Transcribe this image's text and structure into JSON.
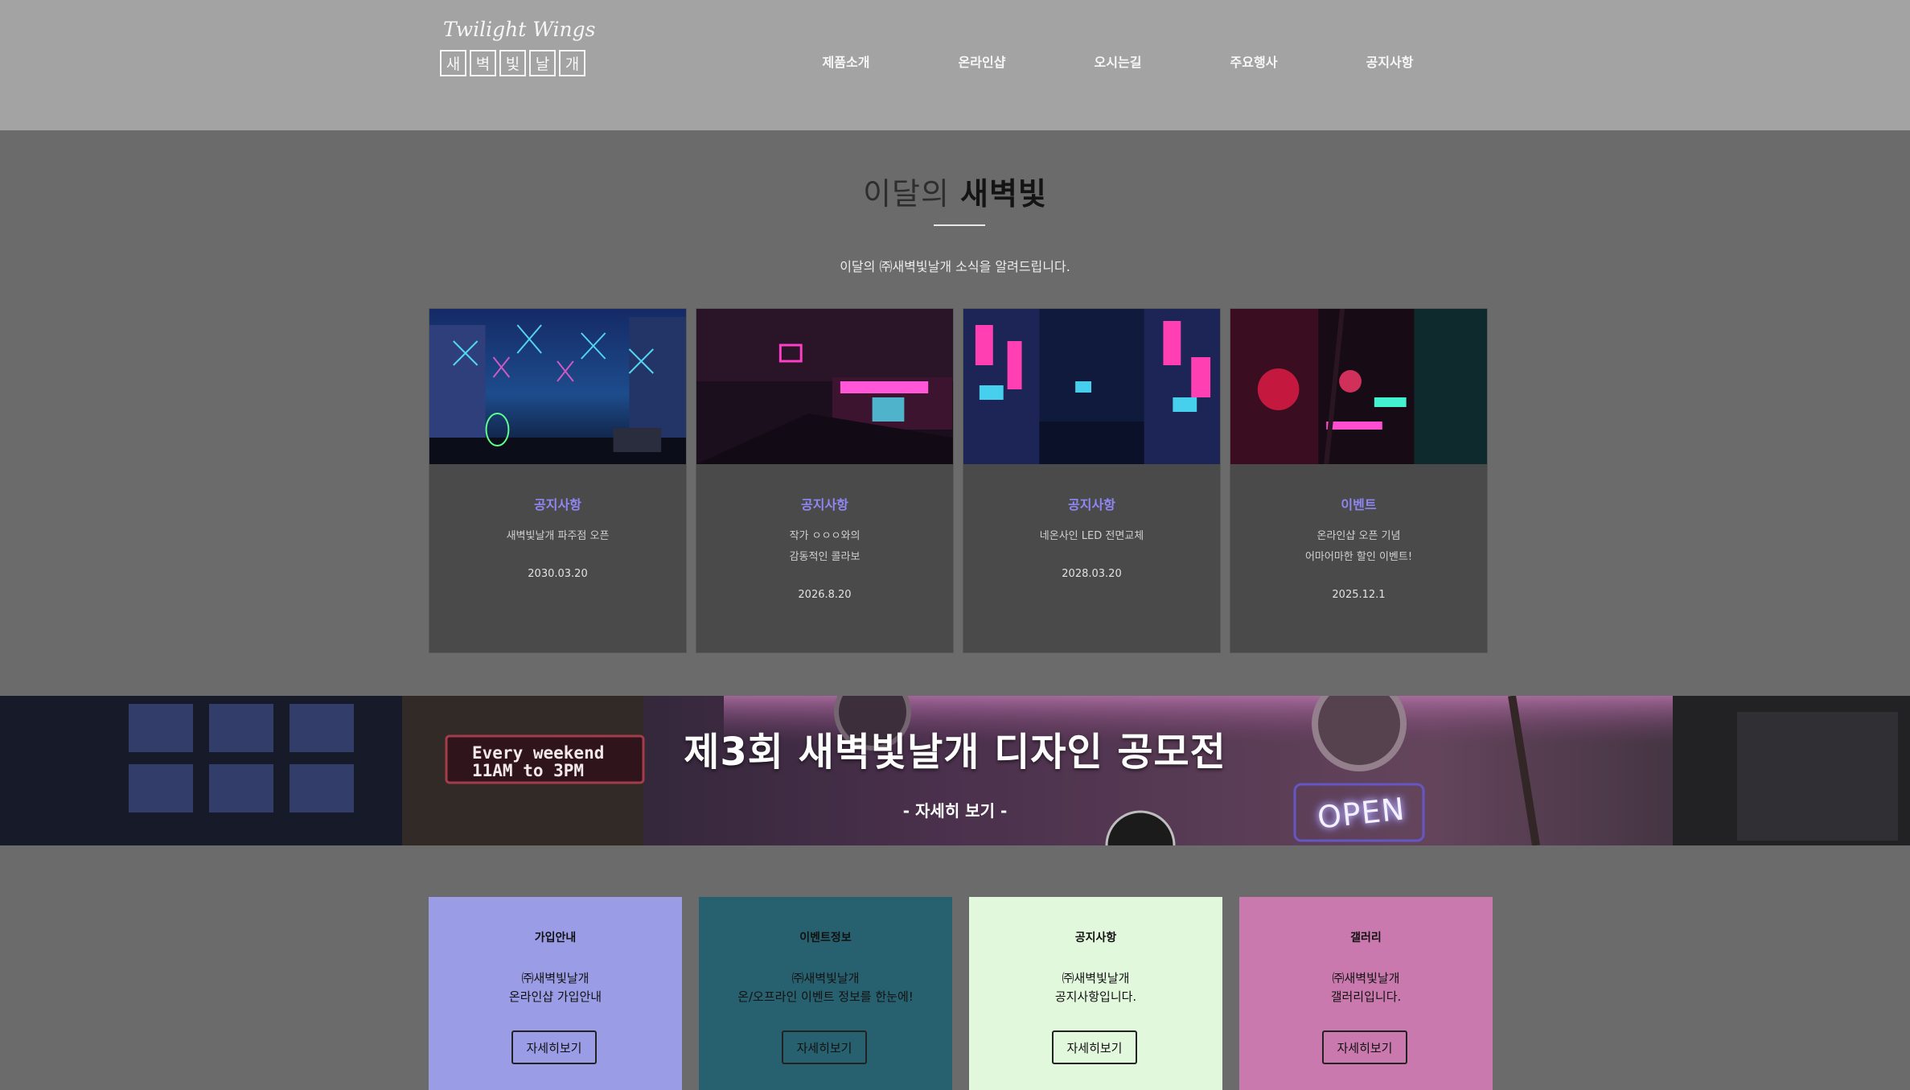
{
  "logo": {
    "script": "Twilight Wings",
    "chars": [
      "새",
      "벽",
      "빛",
      "날",
      "개"
    ]
  },
  "nav": {
    "items": [
      "제품소개",
      "온라인샵",
      "오시는길",
      "주요행사",
      "공지사항"
    ]
  },
  "section": {
    "title_light": "이달의",
    "title_bold": "새벽빛",
    "subtitle": "이달의 ㈜새벽빛날개 소식을 알려드립니다."
  },
  "cards": [
    {
      "category": "공지사항",
      "desc1": "새벽빛날개 파주점 오픈",
      "desc2": "",
      "date": "2030.03.20"
    },
    {
      "category": "공지사항",
      "desc1": "작가 ㅇㅇㅇ와의",
      "desc2": "감동적인 콜라보",
      "date": "2026.8.20"
    },
    {
      "category": "공지사항",
      "desc1": "네온사인 LED 전면교체",
      "desc2": "",
      "date": "2028.03.20"
    },
    {
      "category": "이벤트",
      "desc1": "온라인샵 오픈 기념",
      "desc2": "어마어마한 할인 이벤트!",
      "date": "2025.12.1"
    }
  ],
  "banner": {
    "title": "제3회 새벽빛날개 디자인 공모전",
    "more": "- 자세히 보기 -",
    "sign_line1": "Every weekend",
    "sign_line2": "11AM to 3PM",
    "open_sign": "OPEN"
  },
  "infos": [
    {
      "title": "가입안내",
      "line1": "㈜새벽빛날개",
      "line2": "온라인샵 가입안내",
      "button": "자세히보기",
      "bg": "#9a9de6",
      "fg": "#111111"
    },
    {
      "title": "이벤트정보",
      "line1": "㈜새벽빛날개",
      "line2": "온/오프라인 이벤트 정보를 한눈에!",
      "button": "자세히보기",
      "bg": "#27606f",
      "fg": "#111111"
    },
    {
      "title": "공지사항",
      "line1": "㈜새벽빛날개",
      "line2": "공지사항입니다.",
      "button": "자세히보기",
      "bg": "#e2f8dd",
      "fg": "#111111"
    },
    {
      "title": "갤러리",
      "line1": "㈜새벽빛날개",
      "line2": "갤러리입니다.",
      "button": "자세히보기",
      "bg": "#c979ad",
      "fg": "#111111"
    }
  ],
  "colors": {
    "header_bg": "#a3a3a3",
    "page_bg": "#6b6b6b",
    "card_bg": "#4a4a4a",
    "card_category": "#8f86f2"
  }
}
